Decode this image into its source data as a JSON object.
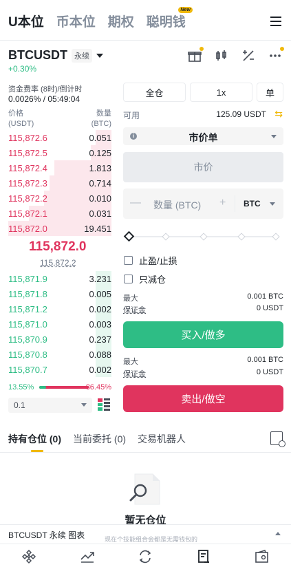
{
  "topnav": {
    "tabs": [
      {
        "label": "U本位",
        "active": true
      },
      {
        "label": "币本位",
        "active": false
      },
      {
        "label": "期权",
        "active": false
      },
      {
        "label": "聪明钱",
        "active": false
      }
    ],
    "new_badge": "New"
  },
  "header": {
    "symbol": "BTCUSDT",
    "contract_type": "永续",
    "change": "+0.30%"
  },
  "funding": {
    "label": "资金费率 (8时)/倒计时",
    "value": "0.0026% / 05:49:04"
  },
  "orderbook": {
    "price_header": "价格",
    "price_unit": "(USDT)",
    "qty_header": "数量",
    "qty_unit": "(BTC)",
    "asks": [
      {
        "price": "115,872.6",
        "qty": "0.051",
        "depth": 0.15
      },
      {
        "price": "115,872.5",
        "qty": "0.125",
        "depth": 0.2
      },
      {
        "price": "115,872.4",
        "qty": "1.813",
        "depth": 0.55
      },
      {
        "price": "115,872.3",
        "qty": "0.714",
        "depth": 0.6
      },
      {
        "price": "115,872.2",
        "qty": "0.010",
        "depth": 0.65
      },
      {
        "price": "115,872.1",
        "qty": "0.031",
        "depth": 0.8
      },
      {
        "price": "115,872.0",
        "qty": "19.451",
        "depth": 1.0
      }
    ],
    "mid_price": "115,872.0",
    "mark_price": "115,872.2",
    "bids": [
      {
        "price": "115,871.9",
        "qty": "3.231",
        "depth": 0.15
      },
      {
        "price": "115,871.8",
        "qty": "0.005",
        "depth": 0.15
      },
      {
        "price": "115,871.2",
        "qty": "0.002",
        "depth": 0.15
      },
      {
        "price": "115,871.0",
        "qty": "0.003",
        "depth": 0.15
      },
      {
        "price": "115,870.9",
        "qty": "0.237",
        "depth": 0.15
      },
      {
        "price": "115,870.8",
        "qty": "0.088",
        "depth": 0.15
      },
      {
        "price": "115,870.7",
        "qty": "0.002",
        "depth": 0.15
      }
    ],
    "buy_ratio": "13.55%",
    "sell_ratio": "86.45%",
    "buy_ratio_value": 0.1355,
    "precision": "0.1"
  },
  "form": {
    "margin_mode": "全仓",
    "leverage": "1x",
    "position_mode": "单",
    "available_label": "可用",
    "available_value": "125.09 USDT",
    "order_type": "市价单",
    "price_placeholder": "市价",
    "qty_placeholder": "数量 (BTC)",
    "qty_unit": "BTC",
    "tp_sl": "止盈/止损",
    "reduce_only": "只减仓",
    "buy": {
      "max_label": "最大",
      "max_value": "0.001 BTC",
      "margin_label": "保证金",
      "margin_value": "0 USDT",
      "button": "买入/做多"
    },
    "sell": {
      "max_label": "最大",
      "max_value": "0.001 BTC",
      "margin_label": "保证金",
      "margin_value": "0 USDT",
      "button": "卖出/做空"
    }
  },
  "positions": {
    "tabs": [
      {
        "label": "持有仓位",
        "count": "(0)",
        "active": true
      },
      {
        "label": "当前委托",
        "count": "(0)",
        "active": false
      },
      {
        "label": "交易机器人",
        "count": "",
        "active": false
      }
    ],
    "empty_text": "暂无仓位"
  },
  "chart_bar": {
    "label": "BTCUSDT 永续  图表",
    "overlay_text": "现在个技能组合会都是无需钱包的"
  },
  "colors": {
    "up": "#2ebd85",
    "down": "#e0345e",
    "accent": "#f0b90b"
  }
}
